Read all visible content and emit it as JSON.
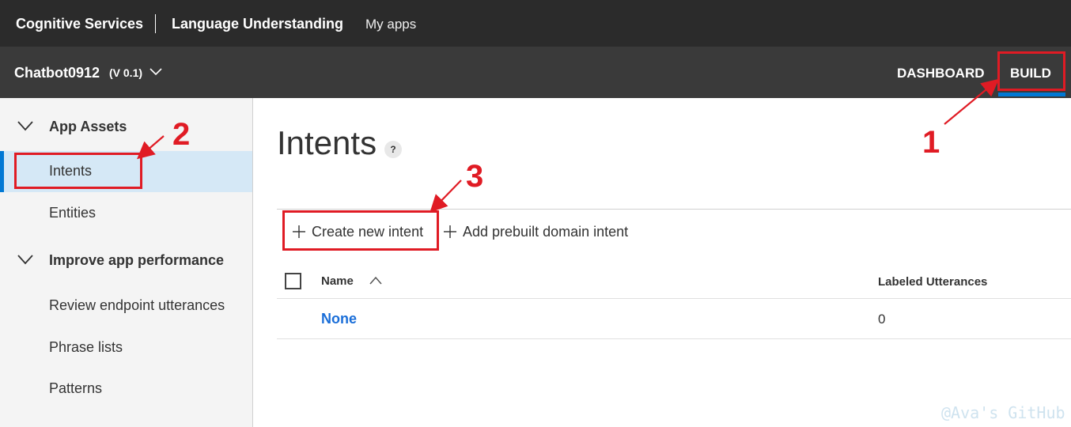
{
  "topbar": {
    "brand": "Cognitive Services",
    "product": "Language Understanding",
    "my_apps": "My apps"
  },
  "appbar": {
    "app_name": "Chatbot0912",
    "version": "(V 0.1)",
    "dashboard": "DASHBOARD",
    "build": "BUILD"
  },
  "sidebar": {
    "groups": [
      {
        "label": "App Assets"
      },
      {
        "label": "Improve app performance"
      }
    ],
    "items": [
      {
        "label": "Intents",
        "active": true
      },
      {
        "label": "Entities"
      },
      {
        "label": "Review endpoint utterances"
      },
      {
        "label": "Phrase lists"
      },
      {
        "label": "Patterns"
      }
    ]
  },
  "main": {
    "title": "Intents",
    "help": "?",
    "toolbar": {
      "create": "Create new intent",
      "add_prebuilt": "Add prebuilt domain intent"
    },
    "grid": {
      "columns": [
        "Name",
        "Labeled Utterances"
      ],
      "rows": [
        {
          "name": "None",
          "labeled_utterances": "0"
        }
      ]
    }
  },
  "annotations": {
    "step1": "1",
    "step2": "2",
    "step3": "3",
    "color": "#e01b24"
  },
  "watermark": "@Ava's GitHub",
  "colors": {
    "accent": "#0078d4",
    "topbar": "#2b2b2b",
    "appbar": "#3a3a3a",
    "link": "#1a6ed8"
  }
}
